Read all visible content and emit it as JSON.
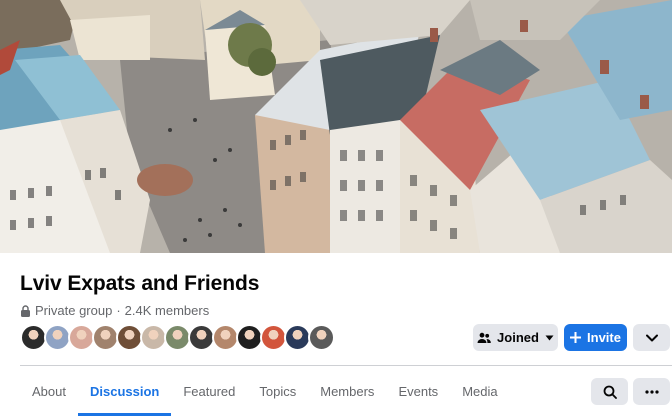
{
  "group": {
    "name": "Lviv Expats and Friends",
    "privacy": "Private group",
    "separator": "·",
    "members": "2.4K members"
  },
  "member_avatars": [
    {
      "color": "#2b2b2b"
    },
    {
      "color": "#8fa3c4"
    },
    {
      "color": "#d8a89a"
    },
    {
      "color": "#a0826d"
    },
    {
      "color": "#6f4e37"
    },
    {
      "color": "#c9b8a8"
    },
    {
      "color": "#7a8a6a"
    },
    {
      "color": "#3a3a3a"
    },
    {
      "color": "#b4876b"
    },
    {
      "color": "#1f1f1f"
    },
    {
      "color": "#d2553c"
    },
    {
      "color": "#2a3a5a"
    },
    {
      "color": "#5a5a5a"
    }
  ],
  "actions": {
    "joined_label": "Joined",
    "invite_label": "Invite",
    "joined_icon": "people-icon",
    "invite_icon": "plus-icon",
    "more_icon": "chevron-down-icon"
  },
  "tabs": [
    {
      "label": "About",
      "active": false
    },
    {
      "label": "Discussion",
      "active": true
    },
    {
      "label": "Featured",
      "active": false
    },
    {
      "label": "Topics",
      "active": false
    },
    {
      "label": "Members",
      "active": false
    },
    {
      "label": "Events",
      "active": false
    },
    {
      "label": "Media",
      "active": false
    }
  ],
  "toolbar": {
    "search_icon": "search-icon",
    "more_icon": "ellipsis-icon"
  },
  "colors": {
    "accent": "#1b74e4",
    "secondary_button": "#e4e6eb",
    "text_primary": "#050505",
    "text_secondary": "#65676b"
  }
}
